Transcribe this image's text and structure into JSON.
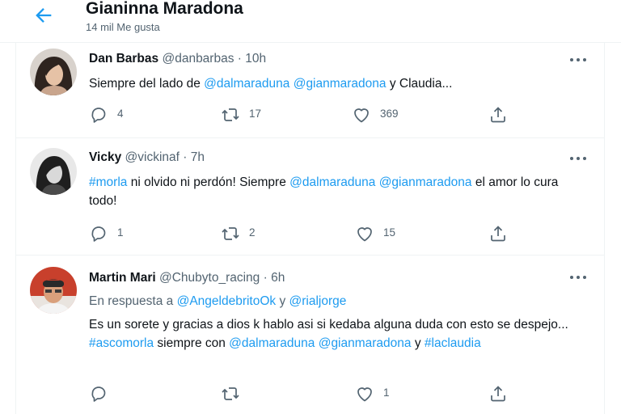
{
  "header": {
    "title": "Gianinna Maradona",
    "subtitle": "14 mil Me gusta"
  },
  "tweets": [
    {
      "name": "Dan Barbas",
      "meta": "@danbarbas · 10h",
      "reply": 4,
      "retweet": 17,
      "like": 369,
      "parts": [
        "Siempre del lado de ",
        "@dalmaraduna",
        " ",
        "@gianmaradona",
        " y Claudia..."
      ]
    },
    {
      "name": "Vicky",
      "meta": "@vickinaf · 7h",
      "reply": 1,
      "retweet": 2,
      "like": 15,
      "parts": [
        "#morla",
        " ni olvido ni perdón!  Siempre ",
        "@dalmaraduna",
        " ",
        "@gianmaradona",
        " el amor lo cura todo!"
      ]
    },
    {
      "name": "Martin Mari",
      "meta": "@Chubyto_racing · 6h",
      "reply_to_prefix": "En respuesta a ",
      "reply_to_1": "@AngeldebritoOk",
      "reply_to_join": " y ",
      "reply_to_2": "@rialjorge",
      "reply": "",
      "retweet": "",
      "like": 1,
      "parts": [
        "Es un sorete y gracias a dios k hablo asi si kedaba alguna duda con esto se despejo... ",
        "#ascomorla",
        " siempre con ",
        "@dalmaraduna",
        " ",
        "@gianmaradona",
        " y ",
        "#laclaudia"
      ]
    }
  ],
  "colors": {
    "accent": "#1d9bf0",
    "muted": "#536471",
    "text": "#0f1419",
    "border": "#eff3f4"
  },
  "icons": [
    "back-arrow-icon",
    "more-icon",
    "reply-icon",
    "retweet-icon",
    "like-icon",
    "share-icon"
  ]
}
